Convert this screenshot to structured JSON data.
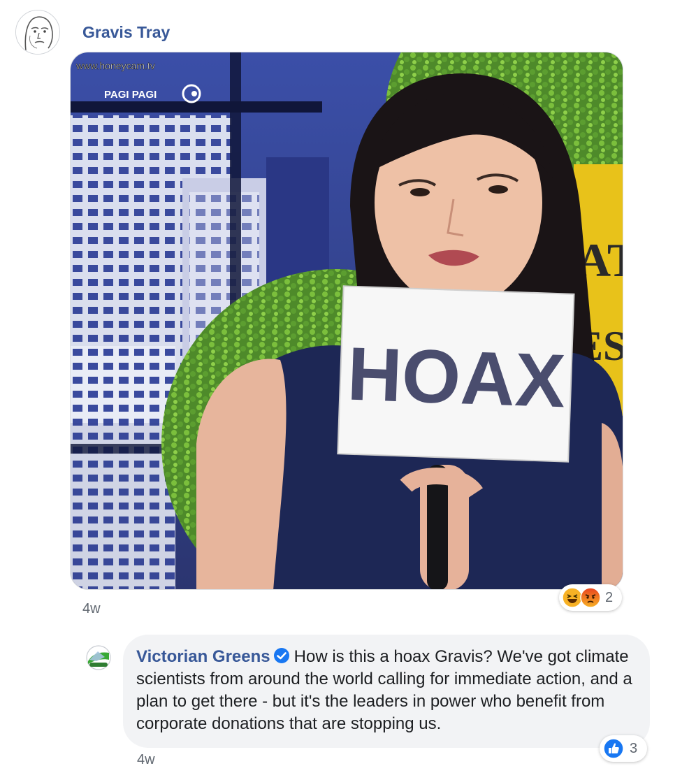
{
  "post": {
    "author": "Gravis Tray",
    "image": {
      "watermark": "www.honeycam.tv",
      "channel_label": "PAGI PAGI",
      "sign_text": "HOAX"
    },
    "reactions": {
      "icons": [
        "haha-icon",
        "angry-icon"
      ],
      "count": "2"
    },
    "timestamp": "4w"
  },
  "reply": {
    "author": "Victorian Greens",
    "verified_icon": "verified-badge-icon",
    "text": "How is this a hoax Gravis? We've got climate scientists from around the world calling for immediate action, and a plan to get there - but it's the leaders in power who benefit from corporate donations that are stopping us.",
    "reactions": {
      "icons": [
        "like-icon"
      ],
      "count": "3"
    },
    "timestamp": "4w"
  },
  "colors": {
    "link": "#385898",
    "bubble": "#f2f3f5",
    "meta": "#606770",
    "like": "#1877f2"
  }
}
